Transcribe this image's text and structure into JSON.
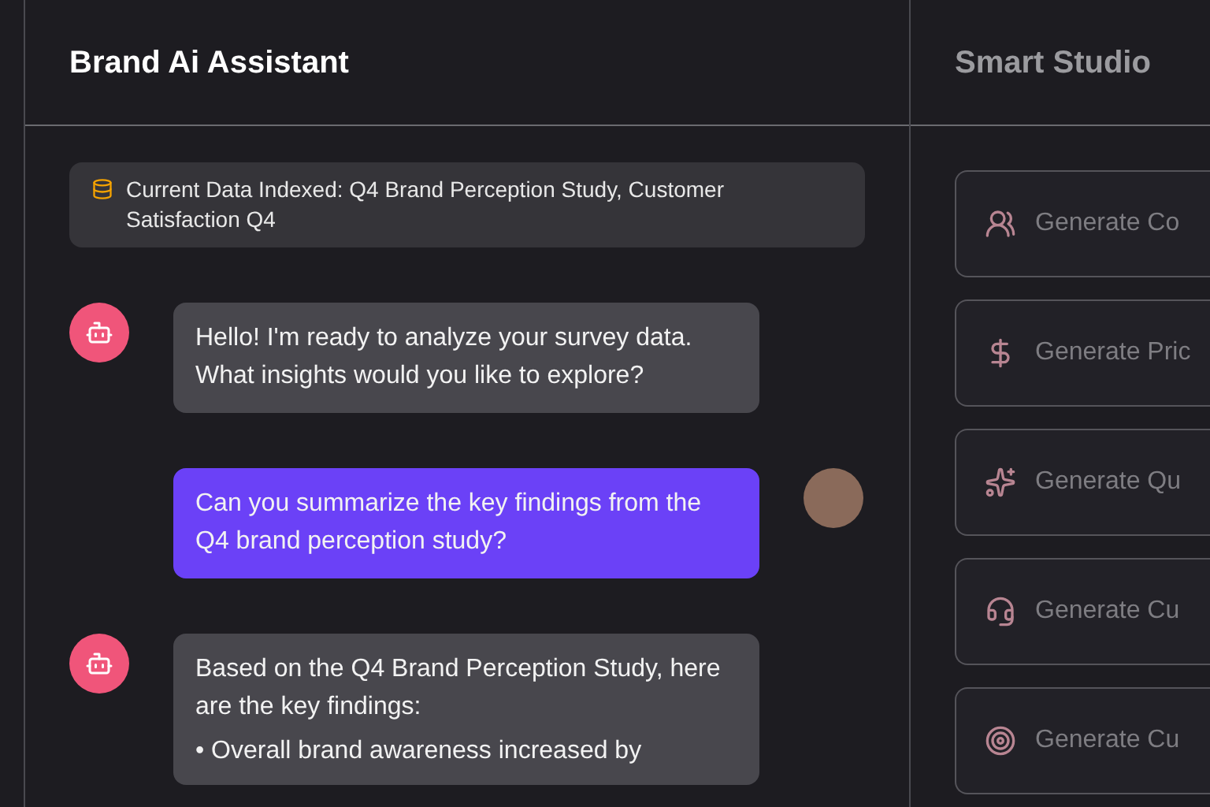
{
  "assistant": {
    "title": "Brand Ai Assistant",
    "indexed_notice": "Current Data Indexed: Q4 Brand Perception Study, Customer Satisfaction Q4",
    "messages": [
      {
        "kind": "bot",
        "text": "Hello! I'm ready to analyze your survey data. What insights would you like to explore?"
      },
      {
        "kind": "user",
        "text": "Can you summarize the key findings from the Q4 brand perception study?"
      },
      {
        "kind": "bot",
        "text": "Based on the Q4 Brand Perception Study, here are the key findings:",
        "bullets": [
          "• Overall brand awareness increased by"
        ]
      }
    ]
  },
  "studio": {
    "title": "Smart Studio",
    "actions": [
      {
        "kind": "users",
        "label": "Generate Co"
      },
      {
        "kind": "dollar",
        "label": "Generate Pric"
      },
      {
        "kind": "sparkles",
        "label": "Generate Qu"
      },
      {
        "kind": "headset",
        "label": "Generate Cu"
      },
      {
        "kind": "target",
        "label": "Generate Cu"
      }
    ]
  }
}
